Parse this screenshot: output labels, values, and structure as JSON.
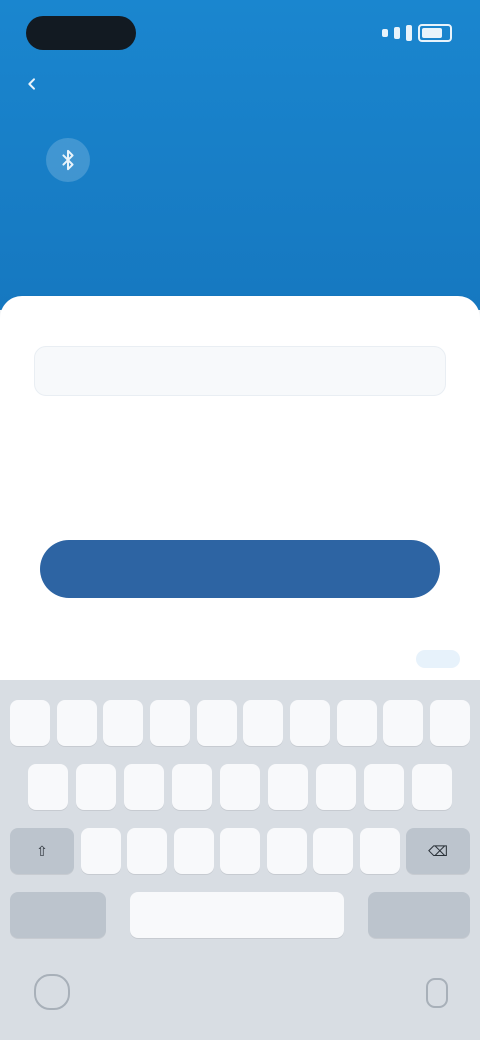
{
  "header": {
    "title": "",
    "subtitle": ""
  },
  "form": {
    "input": {
      "value": "",
      "placeholder": ""
    },
    "primary_button": {
      "label": ""
    }
  },
  "keyboard": {
    "row1": [
      "",
      "",
      "",
      "",
      "",
      "",
      "",
      "",
      "",
      ""
    ],
    "row2": [
      "",
      "",
      "",
      "",
      "",
      "",
      "",
      "",
      ""
    ],
    "row3": [
      "",
      "",
      "",
      "",
      "",
      "",
      ""
    ],
    "row4": {
      "left": "",
      "space": "",
      "return": ""
    }
  },
  "colors": {
    "brand": "#1a86cf",
    "primary_button": "#2d64a3",
    "keyboard_bg": "#d8dde3"
  },
  "icons": {
    "back": "chevron-left-icon",
    "badge": "bluetooth-icon",
    "globe": "globe-icon",
    "mic": "microphone-icon"
  }
}
